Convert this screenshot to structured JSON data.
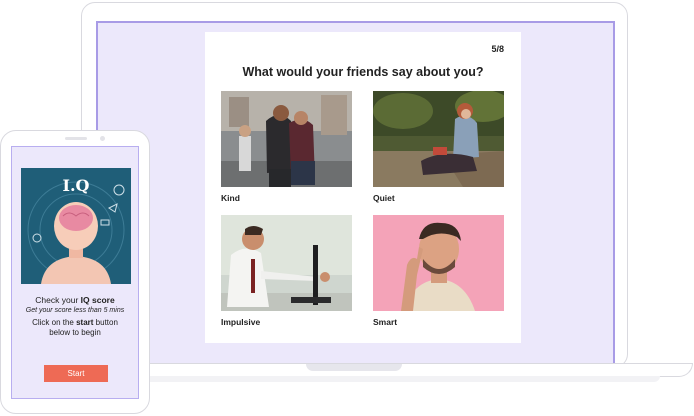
{
  "quiz": {
    "progress": "5/8",
    "question": "What would your friends say about you?",
    "options": [
      {
        "label": "Kind"
      },
      {
        "label": "Quiet"
      },
      {
        "label": "Impulsive"
      },
      {
        "label": "Smart"
      }
    ]
  },
  "phone": {
    "banner_title": "I.Q",
    "line1_prefix": "Check your ",
    "line1_bold": "IQ score",
    "line2": "Get your score less than 5 mins",
    "line3_prefix": "Click on the ",
    "line3_bold": "start",
    "line3_suffix": " button",
    "line4": "below to begin",
    "start_label": "Start"
  },
  "colors": {
    "screen_bg": "#ece8fb",
    "screen_border": "#a89be6",
    "start_button": "#ee6a55",
    "banner_bg": "#1f5e78"
  }
}
